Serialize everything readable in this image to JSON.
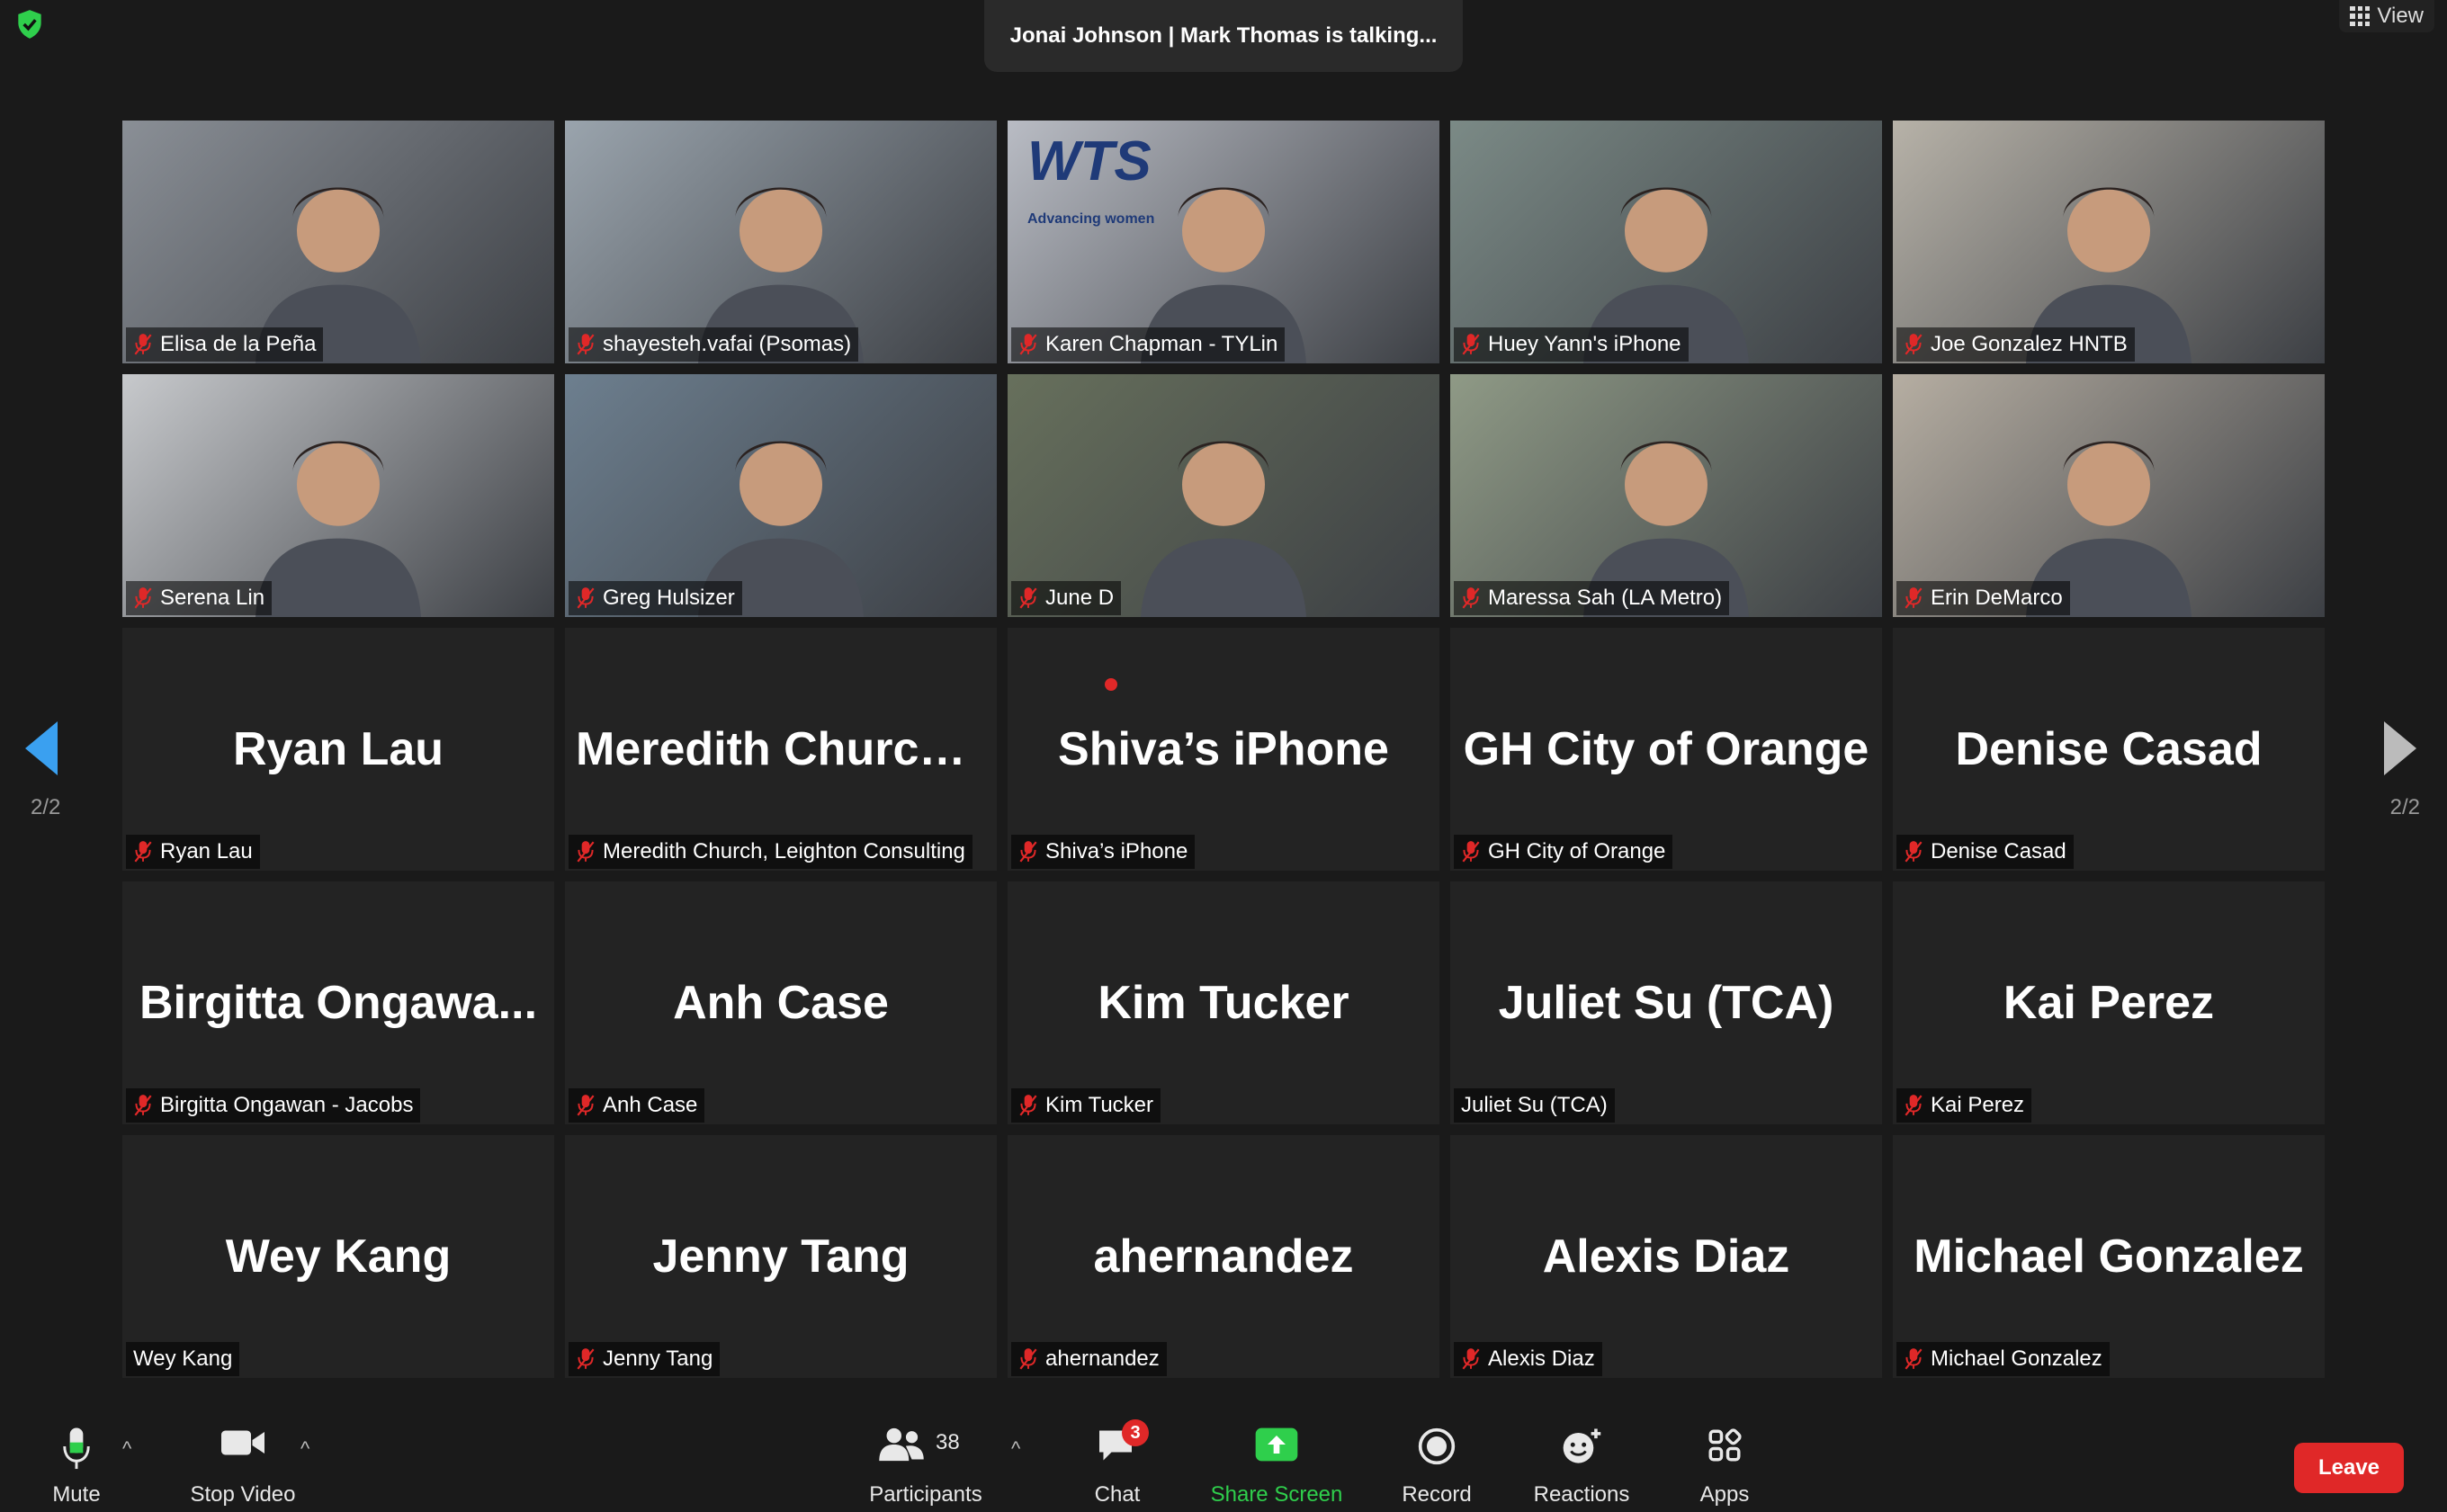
{
  "top": {
    "talking_text": "Jonai Johnson | Mark Thomas is talking...",
    "view_label": "View"
  },
  "page_indicator": "2/2",
  "tiles": [
    {
      "big": "",
      "label": "Elisa de la Peña",
      "muted": true,
      "video": true
    },
    {
      "big": "",
      "label": "shayesteh.vafai (Psomas)",
      "muted": true,
      "video": true
    },
    {
      "big": "",
      "label": "Karen Chapman - TYLin",
      "muted": true,
      "video": true,
      "logo": "WTS",
      "logo_sub": "Advancing women"
    },
    {
      "big": "",
      "label": "Huey Yann's iPhone",
      "muted": true,
      "video": true
    },
    {
      "big": "",
      "label": "Joe Gonzalez HNTB",
      "muted": true,
      "video": true
    },
    {
      "big": "",
      "label": "Serena Lin",
      "muted": true,
      "video": true
    },
    {
      "big": "",
      "label": "Greg Hulsizer",
      "muted": true,
      "video": true
    },
    {
      "big": "",
      "label": "June D",
      "muted": true,
      "video": true
    },
    {
      "big": "",
      "label": "Maressa Sah (LA Metro)",
      "muted": true,
      "video": true
    },
    {
      "big": "",
      "label": "Erin DeMarco",
      "muted": true,
      "video": true
    },
    {
      "big": "Ryan Lau",
      "label": "Ryan Lau",
      "muted": true,
      "video": false
    },
    {
      "big": "Meredith  Church...",
      "label": "Meredith Church, Leighton Consulting",
      "muted": true,
      "video": false
    },
    {
      "big": "Shiva’s iPhone",
      "label": "Shiva’s iPhone",
      "muted": true,
      "video": false,
      "recording": true
    },
    {
      "big": "GH City of Orange",
      "label": "GH City of Orange",
      "muted": true,
      "video": false
    },
    {
      "big": "Denise Casad",
      "label": "Denise Casad",
      "muted": true,
      "video": false
    },
    {
      "big": "Birgitta  Ongawa...",
      "label": "Birgitta Ongawan - Jacobs",
      "muted": true,
      "video": false
    },
    {
      "big": "Anh Case",
      "label": "Anh Case",
      "muted": true,
      "video": false
    },
    {
      "big": "Kim Tucker",
      "label": "Kim Tucker",
      "muted": true,
      "video": false
    },
    {
      "big": "Juliet Su (TCA)",
      "label": "Juliet Su (TCA)",
      "muted": false,
      "video": false
    },
    {
      "big": "Kai Perez",
      "label": "Kai Perez",
      "muted": true,
      "video": false
    },
    {
      "big": "Wey Kang",
      "label": "Wey Kang",
      "muted": false,
      "video": false
    },
    {
      "big": "Jenny Tang",
      "label": "Jenny Tang",
      "muted": true,
      "video": false
    },
    {
      "big": "ahernandez",
      "label": "ahernandez",
      "muted": true,
      "video": false
    },
    {
      "big": "Alexis Diaz",
      "label": "Alexis Diaz",
      "muted": true,
      "video": false
    },
    {
      "big": "Michael Gonzalez",
      "label": "Michael Gonzalez",
      "muted": true,
      "video": false
    }
  ],
  "toolbar": {
    "mute_label": "Mute",
    "stop_video_label": "Stop Video",
    "participants_label": "Participants",
    "participants_count": "38",
    "chat_label": "Chat",
    "chat_badge": "3",
    "share_label": "Share Screen",
    "record_label": "Record",
    "reactions_label": "Reactions",
    "apps_label": "Apps",
    "leave_label": "Leave"
  },
  "colors": {
    "accent_blue": "#3aa0f0",
    "share_green": "#2fcf4c",
    "leave_red": "#e02828",
    "tile_bg": "#232323",
    "app_bg": "#1a1a1a"
  },
  "scene_colors": [
    "#8a8f96",
    "#9aa4ad",
    "#b9bcc4",
    "#7b8a86",
    "#b7b2a8",
    "#c7c9cc",
    "#6d7f8f",
    "#67705c",
    "#8f9a86",
    "#b6aea2"
  ]
}
